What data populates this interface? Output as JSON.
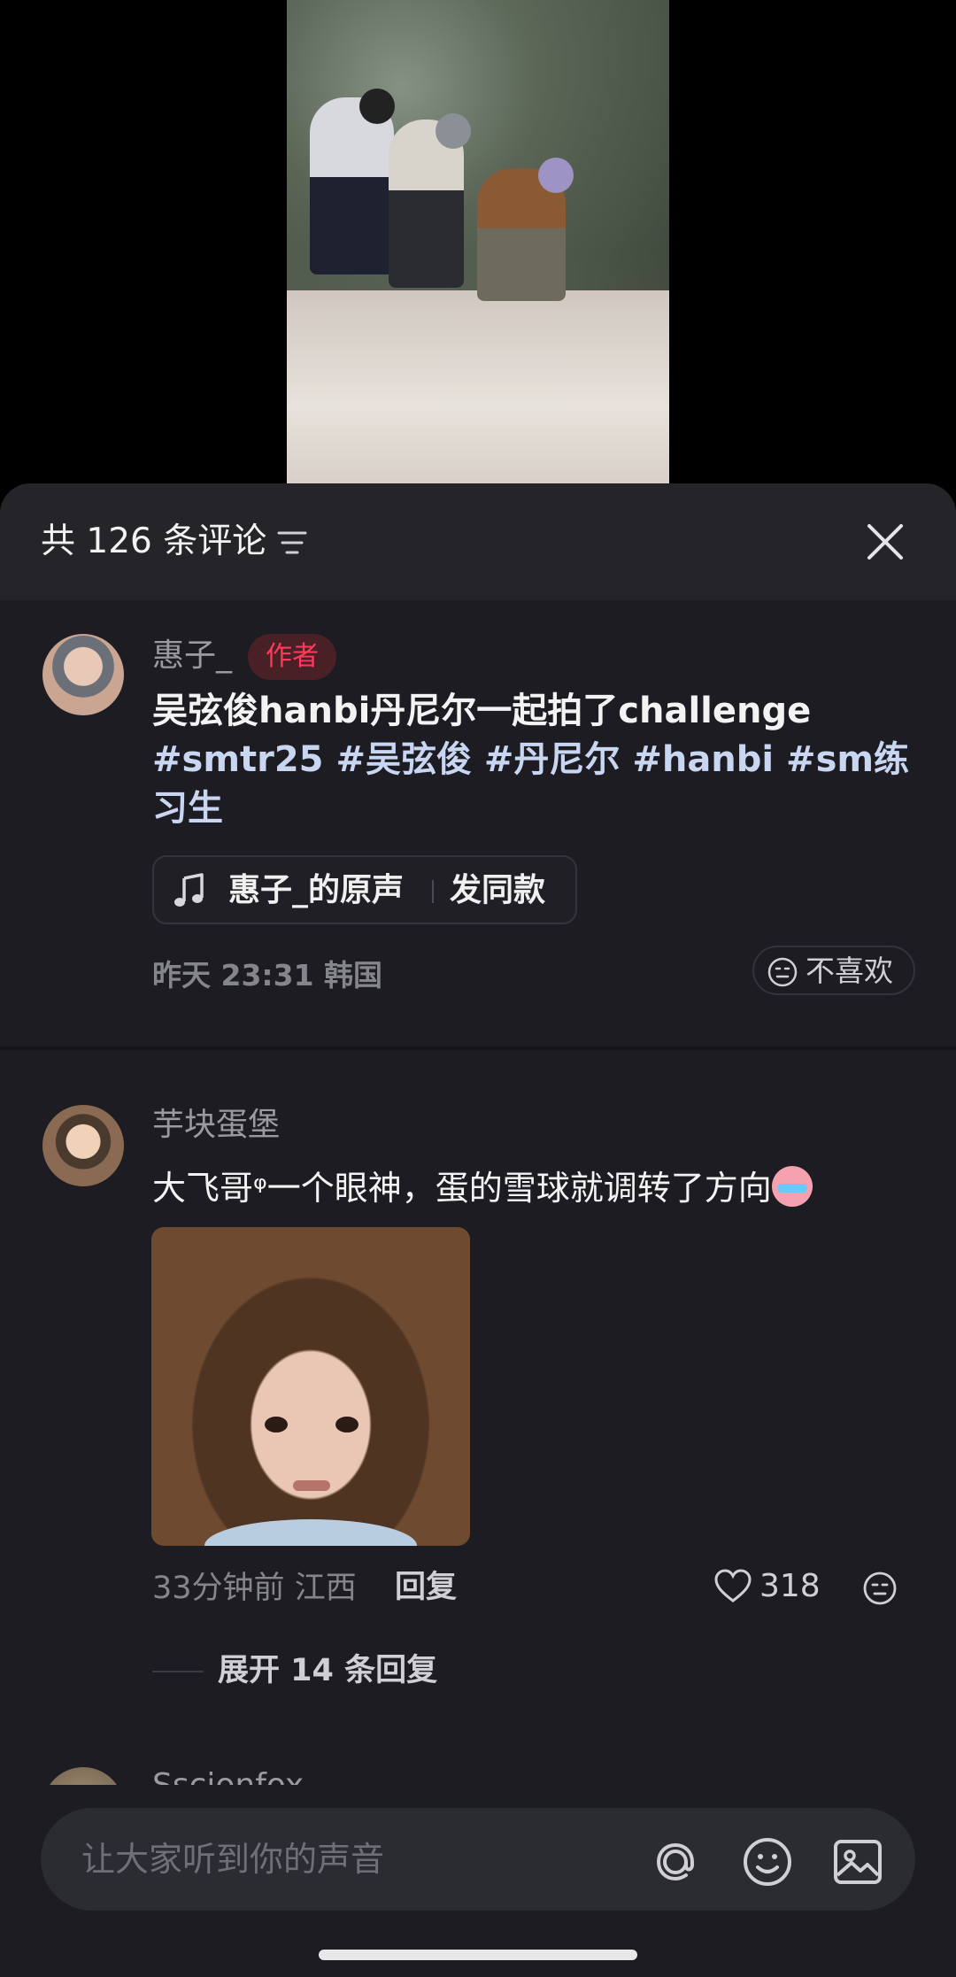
{
  "header": {
    "comment_count_title": "共 126 条评论"
  },
  "author_comment": {
    "username": "惠子_",
    "badge": "作者",
    "text_main": "吴弦俊hanbi丹尼尔一起拍了challenge ",
    "hashtags": "#smtr25 #吴弦俊 #丹尼尔 #hanbi #sm练习生",
    "sound_name": "惠子_的原声",
    "sound_action": "发同款",
    "time": "昨天 23:31",
    "location": "韩国",
    "dislike_label": "不喜欢"
  },
  "comment_2": {
    "username": "芋块蛋堡",
    "text": "大飞哥ᵠ一个眼神，蛋的雪球就调转了方向",
    "time": "33分钟前",
    "location": "江西",
    "reply_label": "回复",
    "like_count": "318",
    "expand_replies_label": "展开 14 条回复"
  },
  "comment_3": {
    "username": "Sscionfox"
  },
  "input": {
    "placeholder": "让大家听到你的声音"
  },
  "colors": {
    "sheet_bg": "#1c1c22",
    "header_bg": "#242429",
    "author_badge_text": "#ff3b5c",
    "hashtag": "#c9d6f2"
  },
  "icons": [
    "filter-icon",
    "close-icon",
    "music-note-icon",
    "neutral-face-icon",
    "heart-icon",
    "reaction-face-icon",
    "at-icon",
    "emoji-icon",
    "image-icon"
  ]
}
